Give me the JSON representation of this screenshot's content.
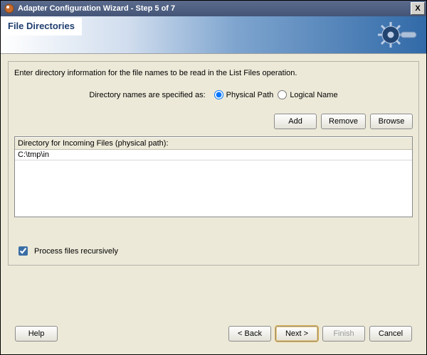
{
  "window": {
    "title": "Adapter Configuration Wizard - Step 5 of 7",
    "close_glyph": "X"
  },
  "banner": {
    "heading": "File Directories"
  },
  "main": {
    "description": "Enter directory information for the file names to be read in the List Files operation.",
    "radio_label": "Directory names are specified as:",
    "radio_physical": "Physical Path",
    "radio_logical": "Logical Name",
    "radio_selected": "physical",
    "buttons": {
      "add": "Add",
      "remove": "Remove",
      "browse": "Browse"
    },
    "table": {
      "header": "Directory for Incoming Files (physical path):",
      "rows": [
        "C:\\tmp\\in"
      ]
    },
    "checkbox": {
      "label": "Process files recursively",
      "checked": true
    }
  },
  "footer": {
    "help": "Help",
    "back": "< Back",
    "next": "Next >",
    "finish": "Finish",
    "cancel": "Cancel",
    "finish_enabled": false
  }
}
